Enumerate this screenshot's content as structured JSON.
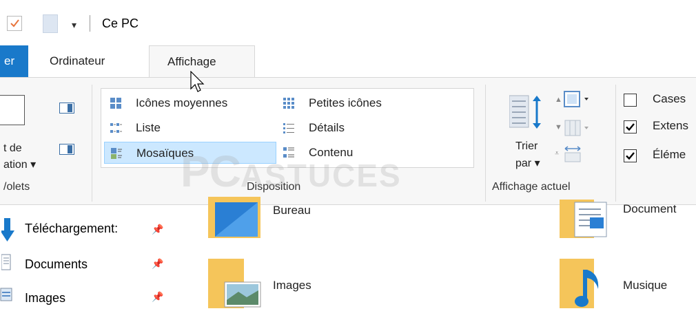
{
  "window": {
    "title": "Ce PC",
    "qa_dropdown": "▾"
  },
  "tabs": {
    "file": "er",
    "ordinateur": "Ordinateur",
    "affichage": "Affichage"
  },
  "ribbon": {
    "volets": {
      "line1": "t de",
      "line2": "ation ▾",
      "group_label": "/olets"
    },
    "layout": {
      "items": [
        {
          "label": "Icônes moyennes",
          "icon": "medium-icons-icon"
        },
        {
          "label": "Petites icônes",
          "icon": "small-icons-icon"
        },
        {
          "label": "Liste",
          "icon": "list-icon"
        },
        {
          "label": "Détails",
          "icon": "details-icon"
        },
        {
          "label": "Mosaïques",
          "icon": "tiles-icon",
          "selected": true
        },
        {
          "label": "Contenu",
          "icon": "content-icon"
        }
      ],
      "group_label": "Disposition"
    },
    "current_view": {
      "sort_line1": "Trier",
      "sort_line2": "par ▾",
      "group_label": "Affichage actuel"
    },
    "show_hide": {
      "items": [
        {
          "label": "Cases",
          "checked": false
        },
        {
          "label": "Extens",
          "checked": true
        },
        {
          "label": "Éléme",
          "checked": true
        }
      ]
    }
  },
  "nav": {
    "items": [
      {
        "label": "Téléchargement:",
        "icon": "download-arrow-icon"
      },
      {
        "label": "Documents",
        "icon": "document-icon"
      },
      {
        "label": "Images",
        "icon": "images-icon"
      }
    ]
  },
  "content": {
    "folders": [
      {
        "label": "Bureau",
        "icon": "desktop-folder-icon"
      },
      {
        "label": "Document",
        "icon": "documents-folder-icon"
      },
      {
        "label": "Images",
        "icon": "pictures-folder-icon"
      },
      {
        "label": "Musique",
        "icon": "music-folder-icon"
      }
    ]
  },
  "watermark": {
    "pc": "PC",
    "astuces": "ASTUCES"
  },
  "colors": {
    "accent": "#1979ca",
    "selected": "#cce8ff",
    "folder": "#f5c55a"
  }
}
